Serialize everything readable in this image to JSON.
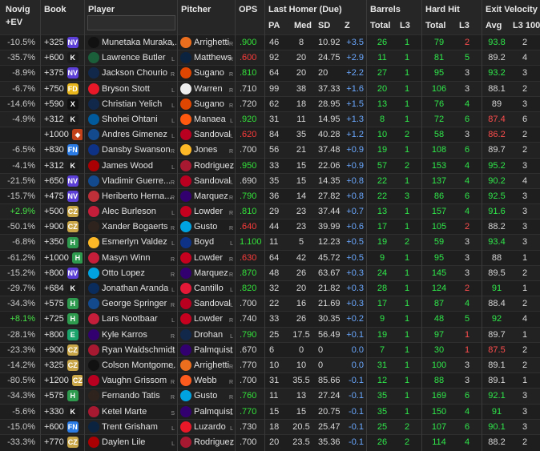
{
  "header": {
    "novig_line1": "Novig",
    "novig_line2": "+EV",
    "book": "Book",
    "player": "Player",
    "pitcher": "Pitcher",
    "ops": "OPS",
    "last_homer": "Last Homer (Due)",
    "barrels": "Barrels",
    "hard_hit": "Hard Hit",
    "exit_velocity": "Exit Velocity",
    "sub": {
      "pa": "PA",
      "med": "Med",
      "sd": "SD",
      "z": "Z",
      "barrels_total": "Total",
      "barrels_l3": "L3",
      "hardhit_total": "Total",
      "hardhit_l3": "L3",
      "ev_avg": "Avg",
      "ev_l3_100": "L3 100"
    }
  },
  "search": {
    "value": "",
    "placeholder": ""
  },
  "colors": {
    "positive_ev": "#46e046",
    "z_score": "#6aa8ff",
    "high": "#2fe84a",
    "low": "#ff4d4d",
    "background": "#1e1e1e"
  },
  "rows": [
    {
      "novig": "-10.5%",
      "book": "+325",
      "book_icon": "NV",
      "book_color": "#5b3fd6",
      "player": "Munetaka Muraka...",
      "team": "CWS",
      "team_color": "#111",
      "player_hand": "L",
      "pitcher": "Arrighetti",
      "pteam": "HOU",
      "pteam_color": "#eb6e1f",
      "pitcher_hand": "R",
      "ops": ".900",
      "ops_c": "g",
      "pa": "46",
      "med": "8",
      "sd": "10.92",
      "z": "+3.5",
      "bt": "26",
      "bl3": "1",
      "ht": "79",
      "hl3": "2",
      "hl3_c": "r",
      "evavg": "93.8",
      "ev_c": "g",
      "evl3": "2"
    },
    {
      "novig": "-35.7%",
      "book": "+600",
      "book_icon": "K",
      "book_color": "#1b1b1b",
      "player": "Lawrence Butler",
      "team": "ATH",
      "team_color": "#1a5e3a",
      "player_hand": "L",
      "pitcher": "Matthews",
      "pteam": "MIN",
      "pteam_color": "#0c2340",
      "pitcher_hand": "R",
      "ops": ".600",
      "ops_c": "r",
      "pa": "92",
      "med": "20",
      "sd": "24.75",
      "z": "+2.9",
      "bt": "11",
      "bl3": "1",
      "ht": "81",
      "hl3": "5",
      "hl3_c": "g",
      "evavg": "89.2",
      "ev_c": "n",
      "evl3": "4"
    },
    {
      "novig": "-8.9%",
      "book": "+375",
      "book_icon": "NV",
      "book_color": "#5b3fd6",
      "player": "Jackson Chourio",
      "team": "MIL",
      "team_color": "#12284b",
      "player_hand": "R",
      "pitcher": "Sugano",
      "pteam": "BAL",
      "pteam_color": "#df4601",
      "pitcher_hand": "R",
      "ops": ".810",
      "ops_c": "g",
      "pa": "64",
      "med": "20",
      "sd": "20",
      "z": "+2.2",
      "bt": "27",
      "bl3": "1",
      "ht": "95",
      "hl3": "3",
      "hl3_c": "n",
      "evavg": "93.2",
      "ev_c": "g",
      "evl3": "3"
    },
    {
      "novig": "-6.7%",
      "book": "+750",
      "book_icon": "FD",
      "book_color": "#e8b61a",
      "player": "Bryson Stott",
      "team": "PHI",
      "team_color": "#e81828",
      "player_hand": "L",
      "pitcher": "Warren",
      "pteam": "NYY",
      "pteam_color": "#eee",
      "pitcher_hand": "R",
      "ops": ".710",
      "ops_c": "n",
      "pa": "99",
      "med": "38",
      "sd": "37.33",
      "z": "+1.6",
      "bt": "20",
      "bl3": "1",
      "ht": "106",
      "hl3": "3",
      "hl3_c": "n",
      "evavg": "88.1",
      "ev_c": "n",
      "evl3": "2"
    },
    {
      "novig": "-14.6%",
      "book": "+590",
      "book_icon": "X",
      "book_color": "#101010",
      "player": "Christian Yelich",
      "team": "MIL",
      "team_color": "#12284b",
      "player_hand": "L",
      "pitcher": "Sugano",
      "pteam": "BAL",
      "pteam_color": "#df4601",
      "pitcher_hand": "R",
      "ops": ".720",
      "ops_c": "n",
      "pa": "62",
      "med": "18",
      "sd": "28.95",
      "z": "+1.5",
      "bt": "13",
      "bl3": "1",
      "ht": "76",
      "hl3": "4",
      "hl3_c": "g",
      "evavg": "89",
      "ev_c": "n",
      "evl3": "3"
    },
    {
      "novig": "-4.9%",
      "book": "+312",
      "book_icon": "K",
      "book_color": "#1b1b1b",
      "player": "Shohei Ohtani",
      "team": "LAD",
      "team_color": "#005a9c",
      "player_hand": "L",
      "pitcher": "Manaea",
      "pteam": "NYM",
      "pteam_color": "#ff5910",
      "pitcher_hand": "L",
      "ops": ".920",
      "ops_c": "g",
      "pa": "31",
      "med": "11",
      "sd": "14.95",
      "z": "+1.3",
      "bt": "8",
      "bl3": "1",
      "ht": "72",
      "hl3": "6",
      "hl3_c": "g",
      "evavg": "87.4",
      "ev_c": "r",
      "evl3": "6"
    },
    {
      "novig": "",
      "book": "+1000",
      "book_icon": "◆",
      "book_color": "#c4421a",
      "player": "Andres Gimenez",
      "team": "TOR",
      "team_color": "#134a8e",
      "player_hand": "L",
      "pitcher": "Sandoval",
      "pteam": "LAA",
      "pteam_color": "#ba0021",
      "pitcher_hand": "L",
      "ops": ".620",
      "ops_c": "r",
      "pa": "84",
      "med": "35",
      "sd": "40.28",
      "z": "+1.2",
      "bt": "10",
      "bl3": "2",
      "ht": "58",
      "hl3": "3",
      "hl3_c": "n",
      "evavg": "86.2",
      "ev_c": "r",
      "evl3": "2"
    },
    {
      "novig": "-6.5%",
      "book": "+830",
      "book_icon": "FN",
      "book_color": "#2a7be4",
      "player": "Dansby Swanson",
      "team": "CHC",
      "team_color": "#0e3386",
      "player_hand": "R",
      "pitcher": "Jones",
      "pteam": "PIT",
      "pteam_color": "#fdb827",
      "pitcher_hand": "R",
      "ops": ".700",
      "ops_c": "n",
      "pa": "56",
      "med": "21",
      "sd": "37.48",
      "z": "+0.9",
      "bt": "19",
      "bl3": "1",
      "ht": "108",
      "hl3": "6",
      "hl3_c": "g",
      "evavg": "89.7",
      "ev_c": "n",
      "evl3": "2"
    },
    {
      "novig": "-4.1%",
      "book": "+312",
      "book_icon": "K",
      "book_color": "#1b1b1b",
      "player": "James Wood",
      "team": "WSH",
      "team_color": "#ab0003",
      "player_hand": "L",
      "pitcher": "Rodriguez",
      "pteam": "ARI",
      "pteam_color": "#a71930",
      "pitcher_hand": "L",
      "ops": ".950",
      "ops_c": "g",
      "pa": "33",
      "med": "15",
      "sd": "22.06",
      "z": "+0.9",
      "bt": "57",
      "bl3": "2",
      "ht": "153",
      "hl3": "4",
      "hl3_c": "g",
      "evavg": "95.2",
      "ev_c": "g",
      "evl3": "3"
    },
    {
      "novig": "-21.5%",
      "book": "+650",
      "book_icon": "NV",
      "book_color": "#5b3fd6",
      "player": "Vladimir Guerre...",
      "team": "TOR",
      "team_color": "#134a8e",
      "player_hand": "R",
      "pitcher": "Sandoval",
      "pteam": "LAA",
      "pteam_color": "#ba0021",
      "pitcher_hand": "L",
      "ops": ".690",
      "ops_c": "n",
      "pa": "35",
      "med": "15",
      "sd": "14.35",
      "z": "+0.8",
      "bt": "22",
      "bl3": "1",
      "ht": "137",
      "hl3": "4",
      "hl3_c": "g",
      "evavg": "90.2",
      "ev_c": "g",
      "evl3": "4"
    },
    {
      "novig": "-15.7%",
      "book": "+475",
      "book_icon": "NV",
      "book_color": "#5b3fd6",
      "player": "Heriberto Herna...",
      "team": "BOS",
      "team_color": "#bd3039",
      "player_hand": "R",
      "pitcher": "Marquez",
      "pteam": "COL",
      "pteam_color": "#33006f",
      "pitcher_hand": "R",
      "ops": ".790",
      "ops_c": "g",
      "pa": "36",
      "med": "14",
      "sd": "27.82",
      "z": "+0.8",
      "bt": "22",
      "bl3": "3",
      "ht": "86",
      "hl3": "6",
      "hl3_c": "g",
      "evavg": "92.5",
      "ev_c": "g",
      "evl3": "3"
    },
    {
      "novig": "+2.9%",
      "book": "+500",
      "book_icon": "CZ",
      "book_color": "#c9a647",
      "player": "Alec Burleson",
      "team": "STL",
      "team_color": "#c41e3a",
      "player_hand": "L",
      "pitcher": "Lowder",
      "pteam": "CIN",
      "pteam_color": "#c6011f",
      "pitcher_hand": "R",
      "ops": ".810",
      "ops_c": "g",
      "pa": "29",
      "med": "23",
      "sd": "37.44",
      "z": "+0.7",
      "bt": "13",
      "bl3": "1",
      "ht": "157",
      "hl3": "4",
      "hl3_c": "g",
      "evavg": "91.6",
      "ev_c": "g",
      "evl3": "3"
    },
    {
      "novig": "-50.1%",
      "book": "+900",
      "book_icon": "CZ",
      "book_color": "#c9a647",
      "player": "Xander Bogaerts",
      "team": "SD",
      "team_color": "#2f241d",
      "player_hand": "R",
      "pitcher": "Gusto",
      "pteam": "MIA",
      "pteam_color": "#00a3e0",
      "pitcher_hand": "R",
      "ops": ".640",
      "ops_c": "r",
      "pa": "44",
      "med": "23",
      "sd": "39.99",
      "z": "+0.6",
      "bt": "17",
      "bl3": "1",
      "ht": "105",
      "hl3": "2",
      "hl3_c": "r",
      "evavg": "88.2",
      "ev_c": "n",
      "evl3": "3"
    },
    {
      "novig": "-6.8%",
      "book": "+350",
      "book_icon": "H",
      "book_color": "#2e9a4e",
      "player": "Esmerlyn Valdez",
      "team": "PIT",
      "team_color": "#fdb827",
      "player_hand": "L",
      "pitcher": "Boyd",
      "pteam": "CHC",
      "pteam_color": "#0e3386",
      "pitcher_hand": "L",
      "ops": "1.100",
      "ops_c": "g",
      "pa": "11",
      "med": "5",
      "sd": "12.23",
      "z": "+0.5",
      "bt": "19",
      "bl3": "2",
      "ht": "59",
      "hl3": "3",
      "hl3_c": "n",
      "evavg": "93.4",
      "ev_c": "g",
      "evl3": "3"
    },
    {
      "novig": "-61.2%",
      "book": "+1000",
      "book_icon": "H",
      "book_color": "#2e9a4e",
      "player": "Masyn Winn",
      "team": "STL",
      "team_color": "#c41e3a",
      "player_hand": "R",
      "pitcher": "Lowder",
      "pteam": "CIN",
      "pteam_color": "#c6011f",
      "pitcher_hand": "R",
      "ops": ".630",
      "ops_c": "r",
      "pa": "64",
      "med": "42",
      "sd": "45.72",
      "z": "+0.5",
      "bt": "9",
      "bl3": "1",
      "ht": "95",
      "hl3": "3",
      "hl3_c": "n",
      "evavg": "88",
      "ev_c": "n",
      "evl3": "1"
    },
    {
      "novig": "-15.2%",
      "book": "+800",
      "book_icon": "NV",
      "book_color": "#5b3fd6",
      "player": "Otto Lopez",
      "team": "MIA",
      "team_color": "#00a3e0",
      "player_hand": "R",
      "pitcher": "Marquez",
      "pteam": "COL",
      "pteam_color": "#33006f",
      "pitcher_hand": "R",
      "ops": ".870",
      "ops_c": "g",
      "pa": "48",
      "med": "26",
      "sd": "63.67",
      "z": "+0.3",
      "bt": "24",
      "bl3": "1",
      "ht": "145",
      "hl3": "3",
      "hl3_c": "n",
      "evavg": "89.5",
      "ev_c": "n",
      "evl3": "2"
    },
    {
      "novig": "-29.7%",
      "book": "+684",
      "book_icon": "K",
      "book_color": "#1b1b1b",
      "player": "Jonathan Aranda",
      "team": "TB",
      "team_color": "#092c5c",
      "player_hand": "L",
      "pitcher": "Cantillo",
      "pteam": "CLE",
      "pteam_color": "#e31937",
      "pitcher_hand": "L",
      "ops": ".820",
      "ops_c": "g",
      "pa": "32",
      "med": "20",
      "sd": "21.82",
      "z": "+0.3",
      "bt": "28",
      "bl3": "1",
      "ht": "124",
      "hl3": "2",
      "hl3_c": "r",
      "evavg": "91",
      "ev_c": "g",
      "evl3": "1"
    },
    {
      "novig": "-34.3%",
      "book": "+575",
      "book_icon": "H",
      "book_color": "#2e9a4e",
      "player": "George Springer",
      "team": "TOR",
      "team_color": "#134a8e",
      "player_hand": "R",
      "pitcher": "Sandoval",
      "pteam": "LAA",
      "pteam_color": "#ba0021",
      "pitcher_hand": "L",
      "ops": ".700",
      "ops_c": "n",
      "pa": "22",
      "med": "16",
      "sd": "21.69",
      "z": "+0.3",
      "bt": "17",
      "bl3": "1",
      "ht": "87",
      "hl3": "4",
      "hl3_c": "g",
      "evavg": "88.4",
      "ev_c": "n",
      "evl3": "2"
    },
    {
      "novig": "+8.1%",
      "book": "+725",
      "book_icon": "H",
      "book_color": "#2e9a4e",
      "player": "Lars Nootbaar",
      "team": "STL",
      "team_color": "#c41e3a",
      "player_hand": "L",
      "pitcher": "Lowder",
      "pteam": "CIN",
      "pteam_color": "#c6011f",
      "pitcher_hand": "R",
      "ops": ".740",
      "ops_c": "n",
      "pa": "33",
      "med": "26",
      "sd": "30.35",
      "z": "+0.2",
      "bt": "9",
      "bl3": "1",
      "ht": "48",
      "hl3": "5",
      "hl3_c": "g",
      "evavg": "92",
      "ev_c": "g",
      "evl3": "4"
    },
    {
      "novig": "-28.1%",
      "book": "+800",
      "book_icon": "E",
      "book_color": "#1aa36b",
      "player": "Kyle Karros",
      "team": "COL",
      "team_color": "#33006f",
      "player_hand": "R",
      "pitcher": "Drohan",
      "pteam": "MIL",
      "pteam_color": "#12284b",
      "pitcher_hand": "L",
      "ops": ".790",
      "ops_c": "g",
      "pa": "25",
      "med": "17.5",
      "sd": "56.49",
      "z": "+0.1",
      "bt": "19",
      "bl3": "1",
      "ht": "97",
      "hl3": "1",
      "hl3_c": "r",
      "evavg": "89.7",
      "ev_c": "n",
      "evl3": "1"
    },
    {
      "novig": "-23.3%",
      "book": "+900",
      "book_icon": "CZ",
      "book_color": "#c9a647",
      "player": "Ryan Waldschmidt",
      "team": "ARI",
      "team_color": "#a71930",
      "player_hand": "R",
      "pitcher": "Palmquist",
      "pteam": "COL",
      "pteam_color": "#33006f",
      "pitcher_hand": "L",
      "ops": ".670",
      "ops_c": "n",
      "pa": "6",
      "med": "0",
      "sd": "0",
      "z": "0.0",
      "bt": "7",
      "bl3": "1",
      "ht": "30",
      "hl3": "1",
      "hl3_c": "r",
      "evavg": "87.5",
      "ev_c": "r",
      "evl3": "2"
    },
    {
      "novig": "-14.2%",
      "book": "+325",
      "book_icon": "CZ",
      "book_color": "#c9a647",
      "player": "Colson Montgome...",
      "team": "CWS",
      "team_color": "#111",
      "player_hand": "L",
      "pitcher": "Arrighetti",
      "pteam": "HOU",
      "pteam_color": "#eb6e1f",
      "pitcher_hand": "R",
      "ops": ".770",
      "ops_c": "n",
      "pa": "10",
      "med": "10",
      "sd": "0",
      "z": "0.0",
      "bt": "31",
      "bl3": "1",
      "ht": "100",
      "hl3": "3",
      "hl3_c": "n",
      "evavg": "89.1",
      "ev_c": "n",
      "evl3": "2"
    },
    {
      "novig": "-80.5%",
      "book": "+1200",
      "book_icon": "CZ",
      "book_color": "#c9a647",
      "player": "Vaughn Grissom",
      "team": "LAA",
      "team_color": "#ba0021",
      "player_hand": "R",
      "pitcher": "Webb",
      "pteam": "SF",
      "pteam_color": "#fd5a1e",
      "pitcher_hand": "R",
      "ops": ".700",
      "ops_c": "n",
      "pa": "31",
      "med": "35.5",
      "sd": "85.66",
      "z": "-0.1",
      "bt": "12",
      "bl3": "1",
      "ht": "88",
      "hl3": "3",
      "hl3_c": "n",
      "evavg": "89.1",
      "ev_c": "n",
      "evl3": "1"
    },
    {
      "novig": "-34.3%",
      "book": "+575",
      "book_icon": "H",
      "book_color": "#2e9a4e",
      "player": "Fernando Tatis",
      "team": "SD",
      "team_color": "#2f241d",
      "player_hand": "R",
      "pitcher": "Gusto",
      "pteam": "MIA",
      "pteam_color": "#00a3e0",
      "pitcher_hand": "R",
      "ops": ".760",
      "ops_c": "g",
      "pa": "11",
      "med": "13",
      "sd": "27.24",
      "z": "-0.1",
      "bt": "35",
      "bl3": "1",
      "ht": "169",
      "hl3": "6",
      "hl3_c": "g",
      "evavg": "92.1",
      "ev_c": "g",
      "evl3": "3"
    },
    {
      "novig": "-5.6%",
      "book": "+330",
      "book_icon": "K",
      "book_color": "#1b1b1b",
      "player": "Ketel Marte",
      "team": "ARI",
      "team_color": "#a71930",
      "player_hand": "S",
      "pitcher": "Palmquist",
      "pteam": "COL",
      "pteam_color": "#33006f",
      "pitcher_hand": "L",
      "ops": ".770",
      "ops_c": "g",
      "pa": "15",
      "med": "15",
      "sd": "20.75",
      "z": "-0.1",
      "bt": "35",
      "bl3": "1",
      "ht": "150",
      "hl3": "4",
      "hl3_c": "g",
      "evavg": "91",
      "ev_c": "g",
      "evl3": "3"
    },
    {
      "novig": "-15.0%",
      "book": "+600",
      "book_icon": "FN",
      "book_color": "#2a7be4",
      "player": "Trent Grisham",
      "team": "NYY",
      "team_color": "#0c2340",
      "player_hand": "L",
      "pitcher": "Luzardo",
      "pteam": "PHI",
      "pteam_color": "#e81828",
      "pitcher_hand": "L",
      "ops": ".730",
      "ops_c": "n",
      "pa": "18",
      "med": "20.5",
      "sd": "25.47",
      "z": "-0.1",
      "bt": "25",
      "bl3": "2",
      "ht": "107",
      "hl3": "6",
      "hl3_c": "g",
      "evavg": "90.1",
      "ev_c": "g",
      "evl3": "3"
    },
    {
      "novig": "-33.3%",
      "book": "+770",
      "book_icon": "CZ",
      "book_color": "#c9a647",
      "player": "Daylen Lile",
      "team": "WSH",
      "team_color": "#ab0003",
      "player_hand": "L",
      "pitcher": "Rodriguez",
      "pteam": "ARI",
      "pteam_color": "#a71930",
      "pitcher_hand": "L",
      "ops": ".700",
      "ops_c": "n",
      "pa": "20",
      "med": "23.5",
      "sd": "35.36",
      "z": "-0.1",
      "bt": "26",
      "bl3": "2",
      "ht": "114",
      "hl3": "4",
      "hl3_c": "g",
      "evavg": "88.2",
      "ev_c": "n",
      "evl3": "2"
    }
  ]
}
